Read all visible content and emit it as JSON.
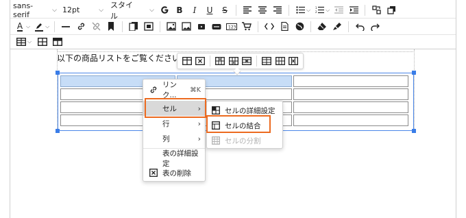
{
  "toolbar": {
    "font_family": "sans-serif",
    "font_size": "12pt",
    "style_label": "スタイル",
    "bold": "B",
    "italic": "I",
    "underline": "U",
    "strike": "S",
    "text_color_letter": "A"
  },
  "content": {
    "paragraph": "以下の商品リストをご覧ください"
  },
  "context_menu": {
    "link_label": "リンク...",
    "link_shortcut": "⌘K",
    "cell_label": "セル",
    "row_label": "行",
    "column_label": "列",
    "table_props_label": "表の詳細設定",
    "delete_table_label": "表の削除"
  },
  "submenu": {
    "cell_props_label": "セルの詳細設定",
    "merge_cells_label": "セルの結合",
    "split_cell_label": "セルの分割"
  },
  "colors": {
    "highlight": "#ec6a1f",
    "selection": "#c7ddf7",
    "handle": "#3a7de8"
  }
}
